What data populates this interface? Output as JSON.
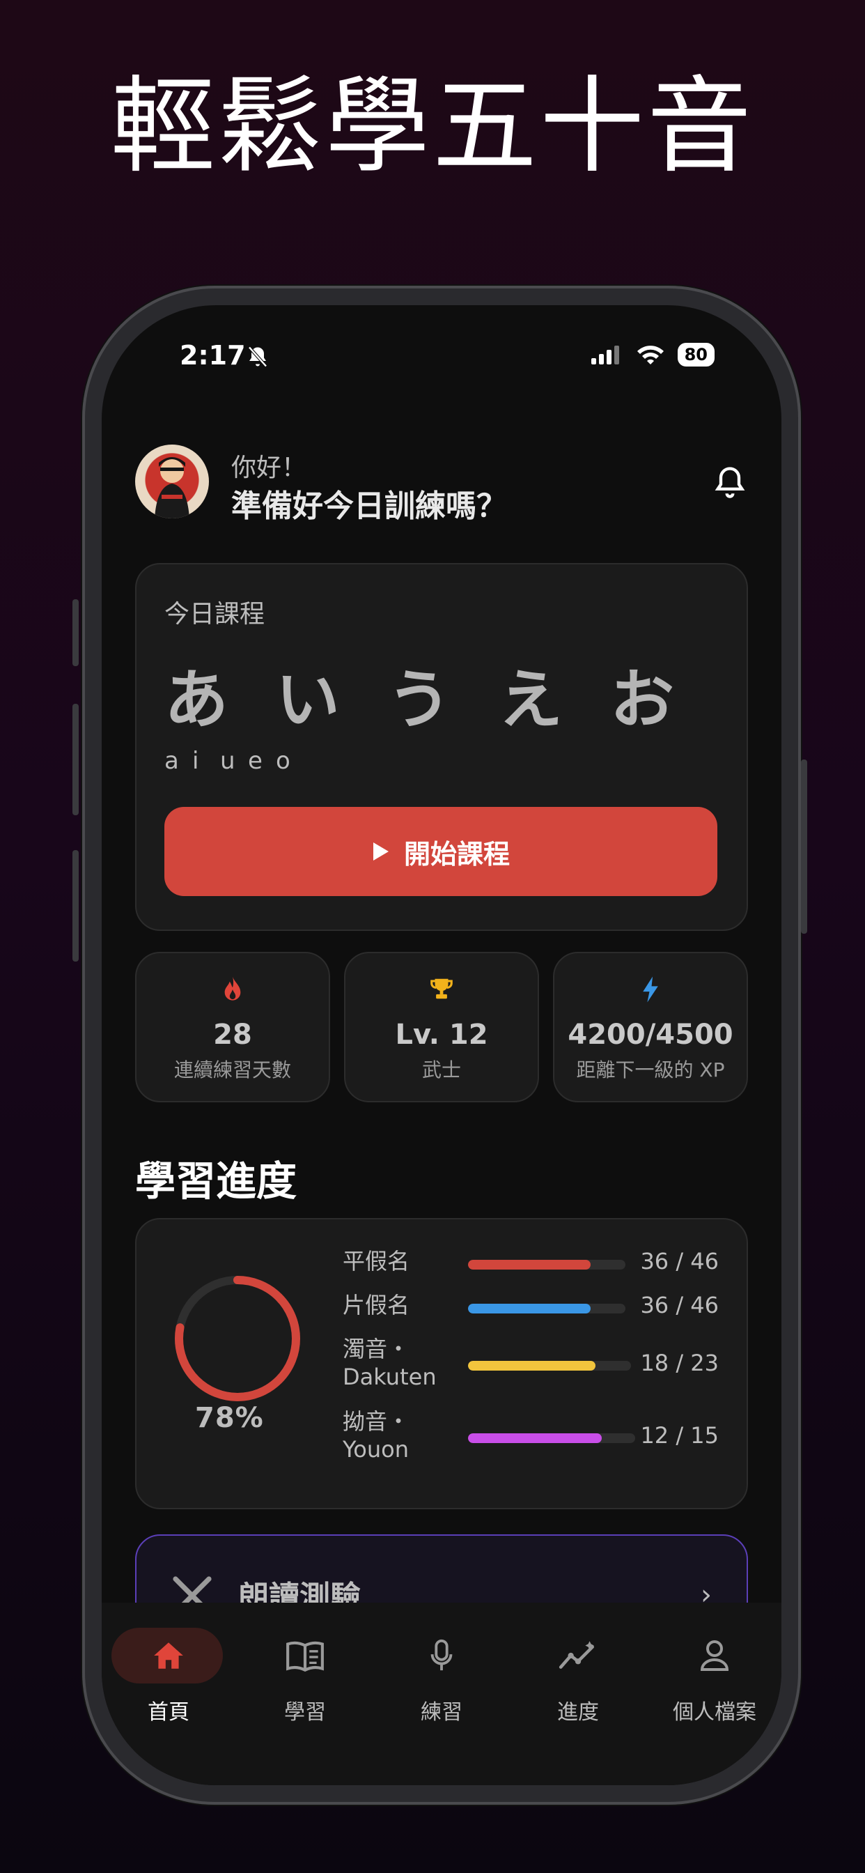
{
  "headline": "輕鬆學五十音",
  "status_bar": {
    "time": "2:17",
    "battery": "80"
  },
  "header": {
    "greeting": "你好！",
    "prompt": "準備好今日訓練嗎？"
  },
  "lesson": {
    "label": "今日課程",
    "kana": [
      "あ",
      "い",
      "う",
      "え",
      "お"
    ],
    "romaji": [
      "a",
      "i",
      "u",
      "e",
      "o"
    ],
    "start_button": "開始課程"
  },
  "stats": [
    {
      "icon": "flame-icon",
      "value": "28",
      "label": "連續練習天數",
      "color": "#e0453a"
    },
    {
      "icon": "trophy-icon",
      "value": "Lv. 12",
      "label": "武士",
      "color": "#f2b21b"
    },
    {
      "icon": "bolt-icon",
      "value": "4200/4500",
      "label": "距離下一級的 XP",
      "color": "#3a97e6"
    }
  ],
  "progress": {
    "title": "學習進度",
    "overall_percent": "78%",
    "overall_fraction": 0.78,
    "rows": [
      {
        "name": "平假名",
        "count": "36 / 46",
        "fraction": 0.78,
        "color": "#d2463c"
      },
      {
        "name": "片假名",
        "count": "36 / 46",
        "fraction": 0.78,
        "color": "#3a97e6"
      },
      {
        "name": "濁音・Dakuten",
        "count": "18 / 23",
        "fraction": 0.78,
        "color": "#f2c53d"
      },
      {
        "name": "拗音・Youon",
        "count": "12 / 15",
        "fraction": 0.8,
        "color": "#c94ee8"
      }
    ]
  },
  "quiz_card": {
    "title": "朗讀測驗"
  },
  "tabbar": {
    "items": [
      {
        "label": "首頁",
        "icon": "home-icon"
      },
      {
        "label": "學習",
        "icon": "book-icon"
      },
      {
        "label": "練習",
        "icon": "microphone-icon"
      },
      {
        "label": "進度",
        "icon": "chart-icon"
      },
      {
        "label": "個人檔案",
        "icon": "profile-icon"
      }
    ]
  }
}
